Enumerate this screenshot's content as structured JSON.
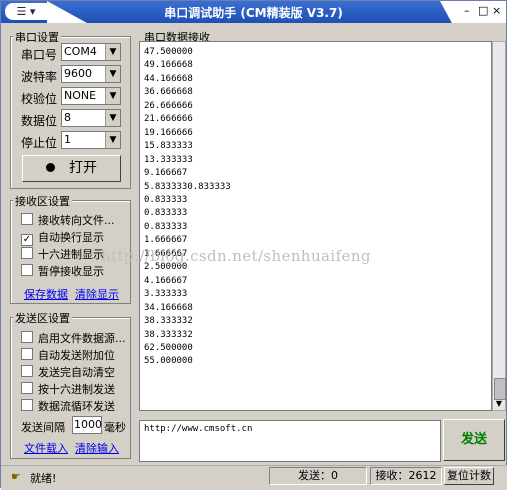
{
  "window": {
    "title": "串口调试助手 (CM精装版 V3.7)",
    "sysmenu_label": "☰ ▾",
    "controls": {
      "minimize": "–",
      "restore": "□",
      "close": "×"
    }
  },
  "serial_settings": {
    "legend": "串口设置",
    "port": {
      "label": "串口号",
      "value": "COM4"
    },
    "baud": {
      "label": "波特率",
      "value": "9600"
    },
    "parity": {
      "label": "校验位",
      "value": "NONE"
    },
    "databits": {
      "label": "数据位",
      "value": "8"
    },
    "stopbits": {
      "label": "停止位",
      "value": "1"
    },
    "open_button": "打开"
  },
  "receive_settings": {
    "legend": "接收区设置",
    "options": [
      {
        "label": "接收转向文件...",
        "checked": false
      },
      {
        "label": "自动换行显示",
        "checked": true
      },
      {
        "label": "十六进制显示",
        "checked": false
      },
      {
        "label": "暂停接收显示",
        "checked": false
      }
    ],
    "save_link": "保存数据",
    "clear_link": "清除显示"
  },
  "send_settings": {
    "legend": "发送区设置",
    "options": [
      {
        "label": "启用文件数据源...",
        "checked": false
      },
      {
        "label": "自动发送附加位",
        "checked": false
      },
      {
        "label": "发送完自动清空",
        "checked": false
      },
      {
        "label": "按十六进制发送",
        "checked": false
      },
      {
        "label": "数据流循环发送",
        "checked": false
      }
    ],
    "interval_label": "发送间隔",
    "interval_value": "1000",
    "interval_unit": "毫秒",
    "load_link": "文件载入",
    "clear_link": "清除输入"
  },
  "receive_area": {
    "legend": "串口数据接收",
    "lines": [
      "47.500000",
      "49.166668",
      "44.166668",
      "36.666668",
      "26.666666",
      "21.666666",
      "19.166666",
      "15.833333",
      "13.333333",
      "9.166667",
      "5.8333330.833333",
      "0.833333",
      "0.833333",
      "0.833333",
      "1.666667",
      "1.666667",
      "2.500000",
      "4.166667",
      "3.333333",
      "34.166668",
      "38.333332",
      "38.333332",
      "62.500000",
      "55.000000"
    ]
  },
  "send_area": {
    "text": "http://www.cmsoft.cn"
  },
  "send_button": "发送",
  "watermark": "http://blog.csdn.net/shenhuaifeng",
  "status_bar": {
    "ready": "就绪!",
    "sent": "发送：0",
    "received": "接收：2612",
    "reset": "复位计数"
  }
}
